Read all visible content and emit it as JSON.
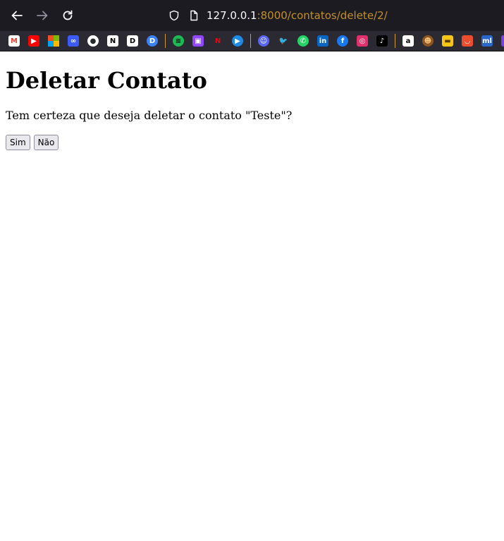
{
  "browser": {
    "url_host": "127.0.0.1",
    "url_rest": ":8000/contatos/delete/2/",
    "bookmarks": [
      {
        "name": "gmail-icon",
        "color": "#ffffff",
        "glyph": "M",
        "fg": "#ea4335"
      },
      {
        "name": "youtube-icon",
        "color": "#ff0000",
        "glyph": "▶",
        "fg": "#ffffff"
      },
      {
        "name": "microsoft-icon",
        "color": "#00a4ef",
        "glyph": "",
        "fg": "#ffffff"
      },
      {
        "name": "bluesky-icon",
        "color": "#3b5bfd",
        "glyph": "∞",
        "fg": "#ffffff"
      },
      {
        "name": "github-icon",
        "color": "#ffffff",
        "glyph": "●",
        "fg": "#24292e"
      },
      {
        "name": "notion-icon",
        "color": "#ffffff",
        "glyph": "N",
        "fg": "#000000"
      },
      {
        "name": "dev-d-icon",
        "color": "#ffffff",
        "glyph": "D",
        "fg": "#000000"
      },
      {
        "name": "d-circle-icon",
        "color": "#3b82f6",
        "glyph": "D",
        "fg": "#ffffff"
      },
      {
        "name": "spotify-icon",
        "color": "#1db954",
        "glyph": "≋",
        "fg": "#000000"
      },
      {
        "name": "twitch-icon",
        "color": "#9146ff",
        "glyph": "▣",
        "fg": "#ffffff"
      },
      {
        "name": "netflix-icon",
        "color": "#2b2a33",
        "glyph": "N",
        "fg": "#e50914"
      },
      {
        "name": "play-circle-icon",
        "color": "#1e88e5",
        "glyph": "▶",
        "fg": "#ffffff"
      },
      {
        "name": "discord-icon",
        "color": "#5865f2",
        "glyph": "☺",
        "fg": "#ffffff"
      },
      {
        "name": "twitter-icon",
        "color": "#2b2a33",
        "glyph": "🐦",
        "fg": "#1da1f2"
      },
      {
        "name": "whatsapp-icon",
        "color": "#25d366",
        "glyph": "✆",
        "fg": "#ffffff"
      },
      {
        "name": "linkedin-icon",
        "color": "#0a66c2",
        "glyph": "in",
        "fg": "#ffffff"
      },
      {
        "name": "facebook-icon",
        "color": "#1877f2",
        "glyph": "f",
        "fg": "#ffffff"
      },
      {
        "name": "instagram-icon",
        "color": "#e1306c",
        "glyph": "◎",
        "fg": "#ffffff"
      },
      {
        "name": "tiktok-icon",
        "color": "#000000",
        "glyph": "♪",
        "fg": "#ffffff"
      },
      {
        "name": "amazon-icon",
        "color": "#ffffff",
        "glyph": "a",
        "fg": "#000000"
      },
      {
        "name": "monkey-icon",
        "color": "#8d5524",
        "glyph": "☻",
        "fg": "#f4c27a"
      },
      {
        "name": "yellow-box-icon",
        "color": "#f5c518",
        "glyph": "▬",
        "fg": "#5a3b00"
      },
      {
        "name": "shopee-icon",
        "color": "#ee4d2d",
        "glyph": "◡",
        "fg": "#ffffff"
      },
      {
        "name": "mercadolivre-icon",
        "color": "#2968c8",
        "glyph": "ml",
        "fg": "#ffffff"
      },
      {
        "name": "purple-icon",
        "color": "#7b3fe4",
        "glyph": "",
        "fg": "#ffffff"
      }
    ]
  },
  "page": {
    "title": "Deletar Contato",
    "message": "Tem certeza que deseja deletar o contato \"Teste\"?",
    "yes_label": "Sim",
    "no_label": "Não"
  }
}
